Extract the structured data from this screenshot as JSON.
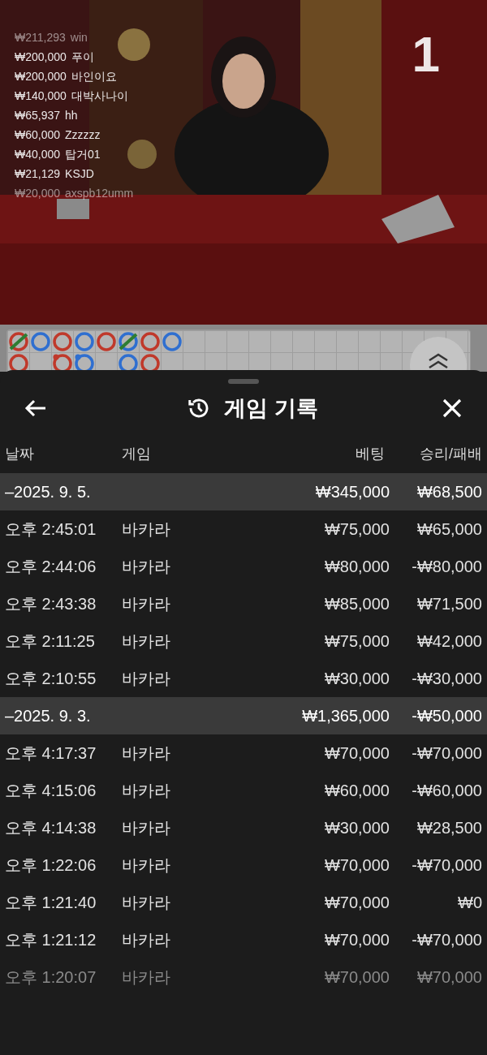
{
  "video": {
    "kind": "picture",
    "round_number": "1",
    "winners": [
      {
        "amount": "₩211,293",
        "name": "win",
        "dimmed": true
      },
      {
        "amount": "₩200,000",
        "name": "푸이",
        "dimmed": false
      },
      {
        "amount": "₩200,000",
        "name": "바인이요",
        "dimmed": false
      },
      {
        "amount": "₩140,000",
        "name": "대박사나이",
        "dimmed": false
      },
      {
        "amount": "₩65,937",
        "name": "hh",
        "dimmed": false
      },
      {
        "amount": "₩60,000",
        "name": "Zzzzzz",
        "dimmed": false
      },
      {
        "amount": "₩40,000",
        "name": "탑거01",
        "dimmed": false
      },
      {
        "amount": "₩21,129",
        "name": "KSJD",
        "dimmed": false
      },
      {
        "amount": "₩20,000",
        "name": "axspb12umm",
        "dimmed": true
      }
    ]
  },
  "bead_road": {
    "columns": [
      {
        "cells": [
          {
            "kind": "bead",
            "color": "#c0392b",
            "tie": true,
            "pair": false
          },
          {
            "kind": "bead",
            "color": "#c0392b",
            "tie": false,
            "pair": false
          }
        ]
      },
      {
        "cells": [
          {
            "kind": "bead",
            "color": "#2f6fd0",
            "tie": false,
            "pair": false
          },
          {
            "kind": "empty"
          }
        ]
      },
      {
        "cells": [
          {
            "kind": "bead",
            "color": "#c0392b",
            "tie": false,
            "pair": false
          },
          {
            "kind": "bead",
            "color": "#c0392b",
            "tie": false,
            "pair": true
          }
        ]
      },
      {
        "cells": [
          {
            "kind": "bead",
            "color": "#2f6fd0",
            "tie": false,
            "pair": false
          },
          {
            "kind": "bead",
            "color": "#2f6fd0",
            "tie": false,
            "pair": true
          }
        ]
      },
      {
        "cells": [
          {
            "kind": "bead",
            "color": "#c0392b",
            "tie": false,
            "pair": false
          },
          {
            "kind": "empty"
          }
        ]
      },
      {
        "cells": [
          {
            "kind": "bead",
            "color": "#2f6fd0",
            "tie": true,
            "pair": false
          },
          {
            "kind": "bead",
            "color": "#2f6fd0",
            "tie": false,
            "pair": false
          }
        ]
      },
      {
        "cells": [
          {
            "kind": "bead",
            "color": "#c0392b",
            "tie": false,
            "pair": false
          },
          {
            "kind": "bead",
            "color": "#c0392b",
            "tie": false,
            "pair": false
          }
        ]
      },
      {
        "cells": [
          {
            "kind": "bead",
            "color": "#2f6fd0",
            "tie": false,
            "pair": false
          },
          {
            "kind": "empty"
          }
        ]
      }
    ]
  },
  "sheet": {
    "title": "게임 기록",
    "table": {
      "columns": [
        "날짜",
        "게임",
        "베팅",
        "승리/패배"
      ],
      "rows": [
        {
          "kind": "date",
          "date": "–2025. 9. 5.",
          "bet": "₩345,000",
          "result": "₩68,500"
        },
        {
          "kind": "game",
          "time": "오후 2:45:01",
          "game": "바카라",
          "bet": "₩75,000",
          "result": "₩65,000",
          "dimmed": false
        },
        {
          "kind": "game",
          "time": "오후 2:44:06",
          "game": "바카라",
          "bet": "₩80,000",
          "result": "-₩80,000",
          "dimmed": false
        },
        {
          "kind": "game",
          "time": "오후 2:43:38",
          "game": "바카라",
          "bet": "₩85,000",
          "result": "₩71,500",
          "dimmed": false
        },
        {
          "kind": "game",
          "time": "오후 2:11:25",
          "game": "바카라",
          "bet": "₩75,000",
          "result": "₩42,000",
          "dimmed": false
        },
        {
          "kind": "game",
          "time": "오후 2:10:55",
          "game": "바카라",
          "bet": "₩30,000",
          "result": "-₩30,000",
          "dimmed": false
        },
        {
          "kind": "date",
          "date": "–2025. 9. 3.",
          "bet": "₩1,365,000",
          "result": "-₩50,000"
        },
        {
          "kind": "game",
          "time": "오후 4:17:37",
          "game": "바카라",
          "bet": "₩70,000",
          "result": "-₩70,000",
          "dimmed": false
        },
        {
          "kind": "game",
          "time": "오후 4:15:06",
          "game": "바카라",
          "bet": "₩60,000",
          "result": "-₩60,000",
          "dimmed": false
        },
        {
          "kind": "game",
          "time": "오후 4:14:38",
          "game": "바카라",
          "bet": "₩30,000",
          "result": "₩28,500",
          "dimmed": false
        },
        {
          "kind": "game",
          "time": "오후 1:22:06",
          "game": "바카라",
          "bet": "₩70,000",
          "result": "-₩70,000",
          "dimmed": false
        },
        {
          "kind": "game",
          "time": "오후 1:21:40",
          "game": "바카라",
          "bet": "₩70,000",
          "result": "₩0",
          "dimmed": false
        },
        {
          "kind": "game",
          "time": "오후 1:21:12",
          "game": "바카라",
          "bet": "₩70,000",
          "result": "-₩70,000",
          "dimmed": false
        },
        {
          "kind": "game",
          "time": "오후 1:20:07",
          "game": "바카라",
          "bet": "₩70,000",
          "result": "₩70,000",
          "dimmed": true
        }
      ]
    }
  }
}
